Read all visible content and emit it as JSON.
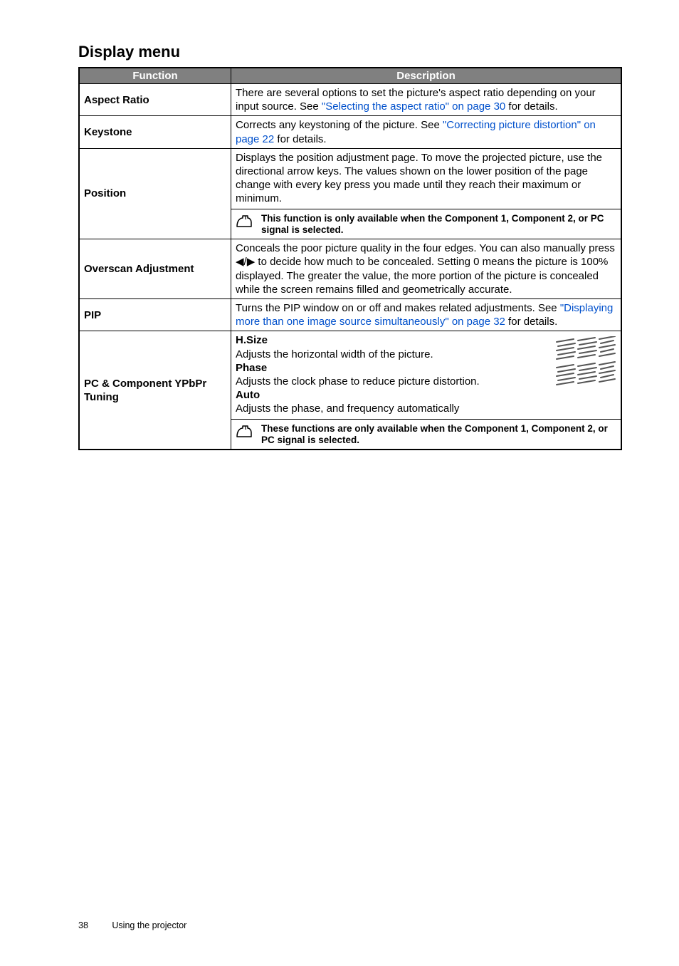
{
  "section_title": "Display menu",
  "table": {
    "headers": {
      "function": "Function",
      "description": "Description"
    },
    "rows": [
      {
        "fn": "Aspect Ratio",
        "desc_pre": "There are several options to set the picture's aspect ratio depending on your input source. See ",
        "link": "\"Selecting the aspect ratio\" on page 30",
        "desc_post": " for details."
      },
      {
        "fn": "Keystone",
        "desc_pre": "Corrects any keystoning of the picture. See ",
        "link": "\"Correcting picture distortion\" on page 22",
        "desc_post": " for details."
      },
      {
        "fn": "Position",
        "desc": "Displays the position adjustment page. To move the projected picture, use the directional arrow keys. The values shown on the lower position of the page change with every key press you made until they reach their maximum or minimum.",
        "note": "This function is only available when the Component 1, Component 2, or PC signal is selected."
      },
      {
        "fn": "Overscan Adjustment",
        "desc": "Conceals the poor picture quality in the four edges. You can also manually press ◀/▶ to decide how much to be concealed. Setting 0 means the picture is 100% displayed. The greater the value, the more portion of the picture is concealed while the screen remains filled and geometrically accurate."
      },
      {
        "fn": "PIP",
        "desc_pre": "Turns the PIP window on or off and makes related adjustments. See ",
        "link": "\"Displaying more than one image source simultaneously\" on page 32",
        "desc_post": " for details."
      },
      {
        "fn": "PC & Component YPbPr Tuning",
        "sub": [
          {
            "head": "H.Size",
            "body": "Adjusts the horizontal width of the picture."
          },
          {
            "head": "Phase",
            "body": "Adjusts the clock phase to reduce picture distortion."
          },
          {
            "head": "Auto",
            "body": "Adjusts the phase, and frequency automatically"
          }
        ],
        "note": "These functions are only available when the Component 1, Component 2, or PC signal is selected."
      }
    ]
  },
  "footer": {
    "page_number": "38",
    "section_name": "Using the projector"
  }
}
